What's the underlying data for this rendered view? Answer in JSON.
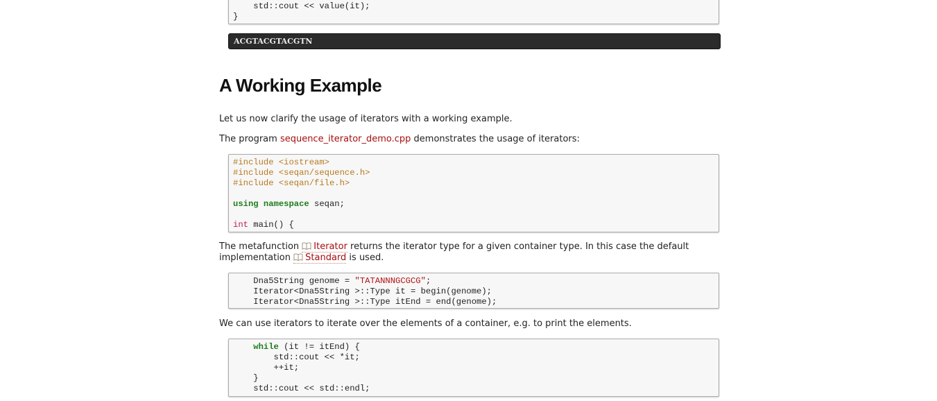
{
  "snippet_top": {
    "lines": [
      {
        "indent": "    ",
        "code": "std::cout << value(it);"
      },
      {
        "indent": "",
        "code": "}"
      }
    ]
  },
  "output": "ACGTACGTACGTN",
  "section_title": "A Working Example",
  "intro": "Let us now clarify the usage of iterators with a working example.",
  "program": {
    "before": "The program ",
    "link": "sequence_iterator_demo.cpp",
    "after": " demonstrates the usage of iterators:"
  },
  "listing_includes": {
    "inc1": "#include <iostream>",
    "inc2": "#include <seqan/sequence.h>",
    "inc3": "#include <seqan/file.h>",
    "using_kw": "using",
    "namespace_kw": "namespace",
    "using_rest": " seqan;",
    "int_kw": "int",
    "main_rest": " main() {"
  },
  "metafunction": {
    "before": "The metafunction ",
    "link1": "Iterator",
    "middle": " returns the iterator type for a given container type. In this case the default implementation ",
    "link2": "Standard",
    "after": " is used."
  },
  "listing_types": {
    "l1_pre": "    Dna5String genome = ",
    "l1_str": "\"TATANNNGCGCG\"",
    "l1_post": ";",
    "l2": "    Iterator<Dna5String >::Type it = begin(genome);",
    "l3": "    Iterator<Dna5String >::Type itEnd = end(genome);"
  },
  "iterate_text": "We can use iterators to iterate over the elements of a container, e.g. to print the elements.",
  "listing_loop": {
    "while_indent": "    ",
    "while_kw": "while",
    "while_rest": " (it != itEnd) {",
    "l2": "        std::cout << *it;",
    "l3": "        ++it;",
    "l4": "    }",
    "l5": "    std::cout << std::endl;"
  },
  "icons": {
    "doc": "book-icon"
  },
  "colors": {
    "link": "#a50e0e",
    "preprocessor": "#b7791f",
    "keyword": "#1e7d1e",
    "type": "#c0185a",
    "string": "#b31212"
  }
}
